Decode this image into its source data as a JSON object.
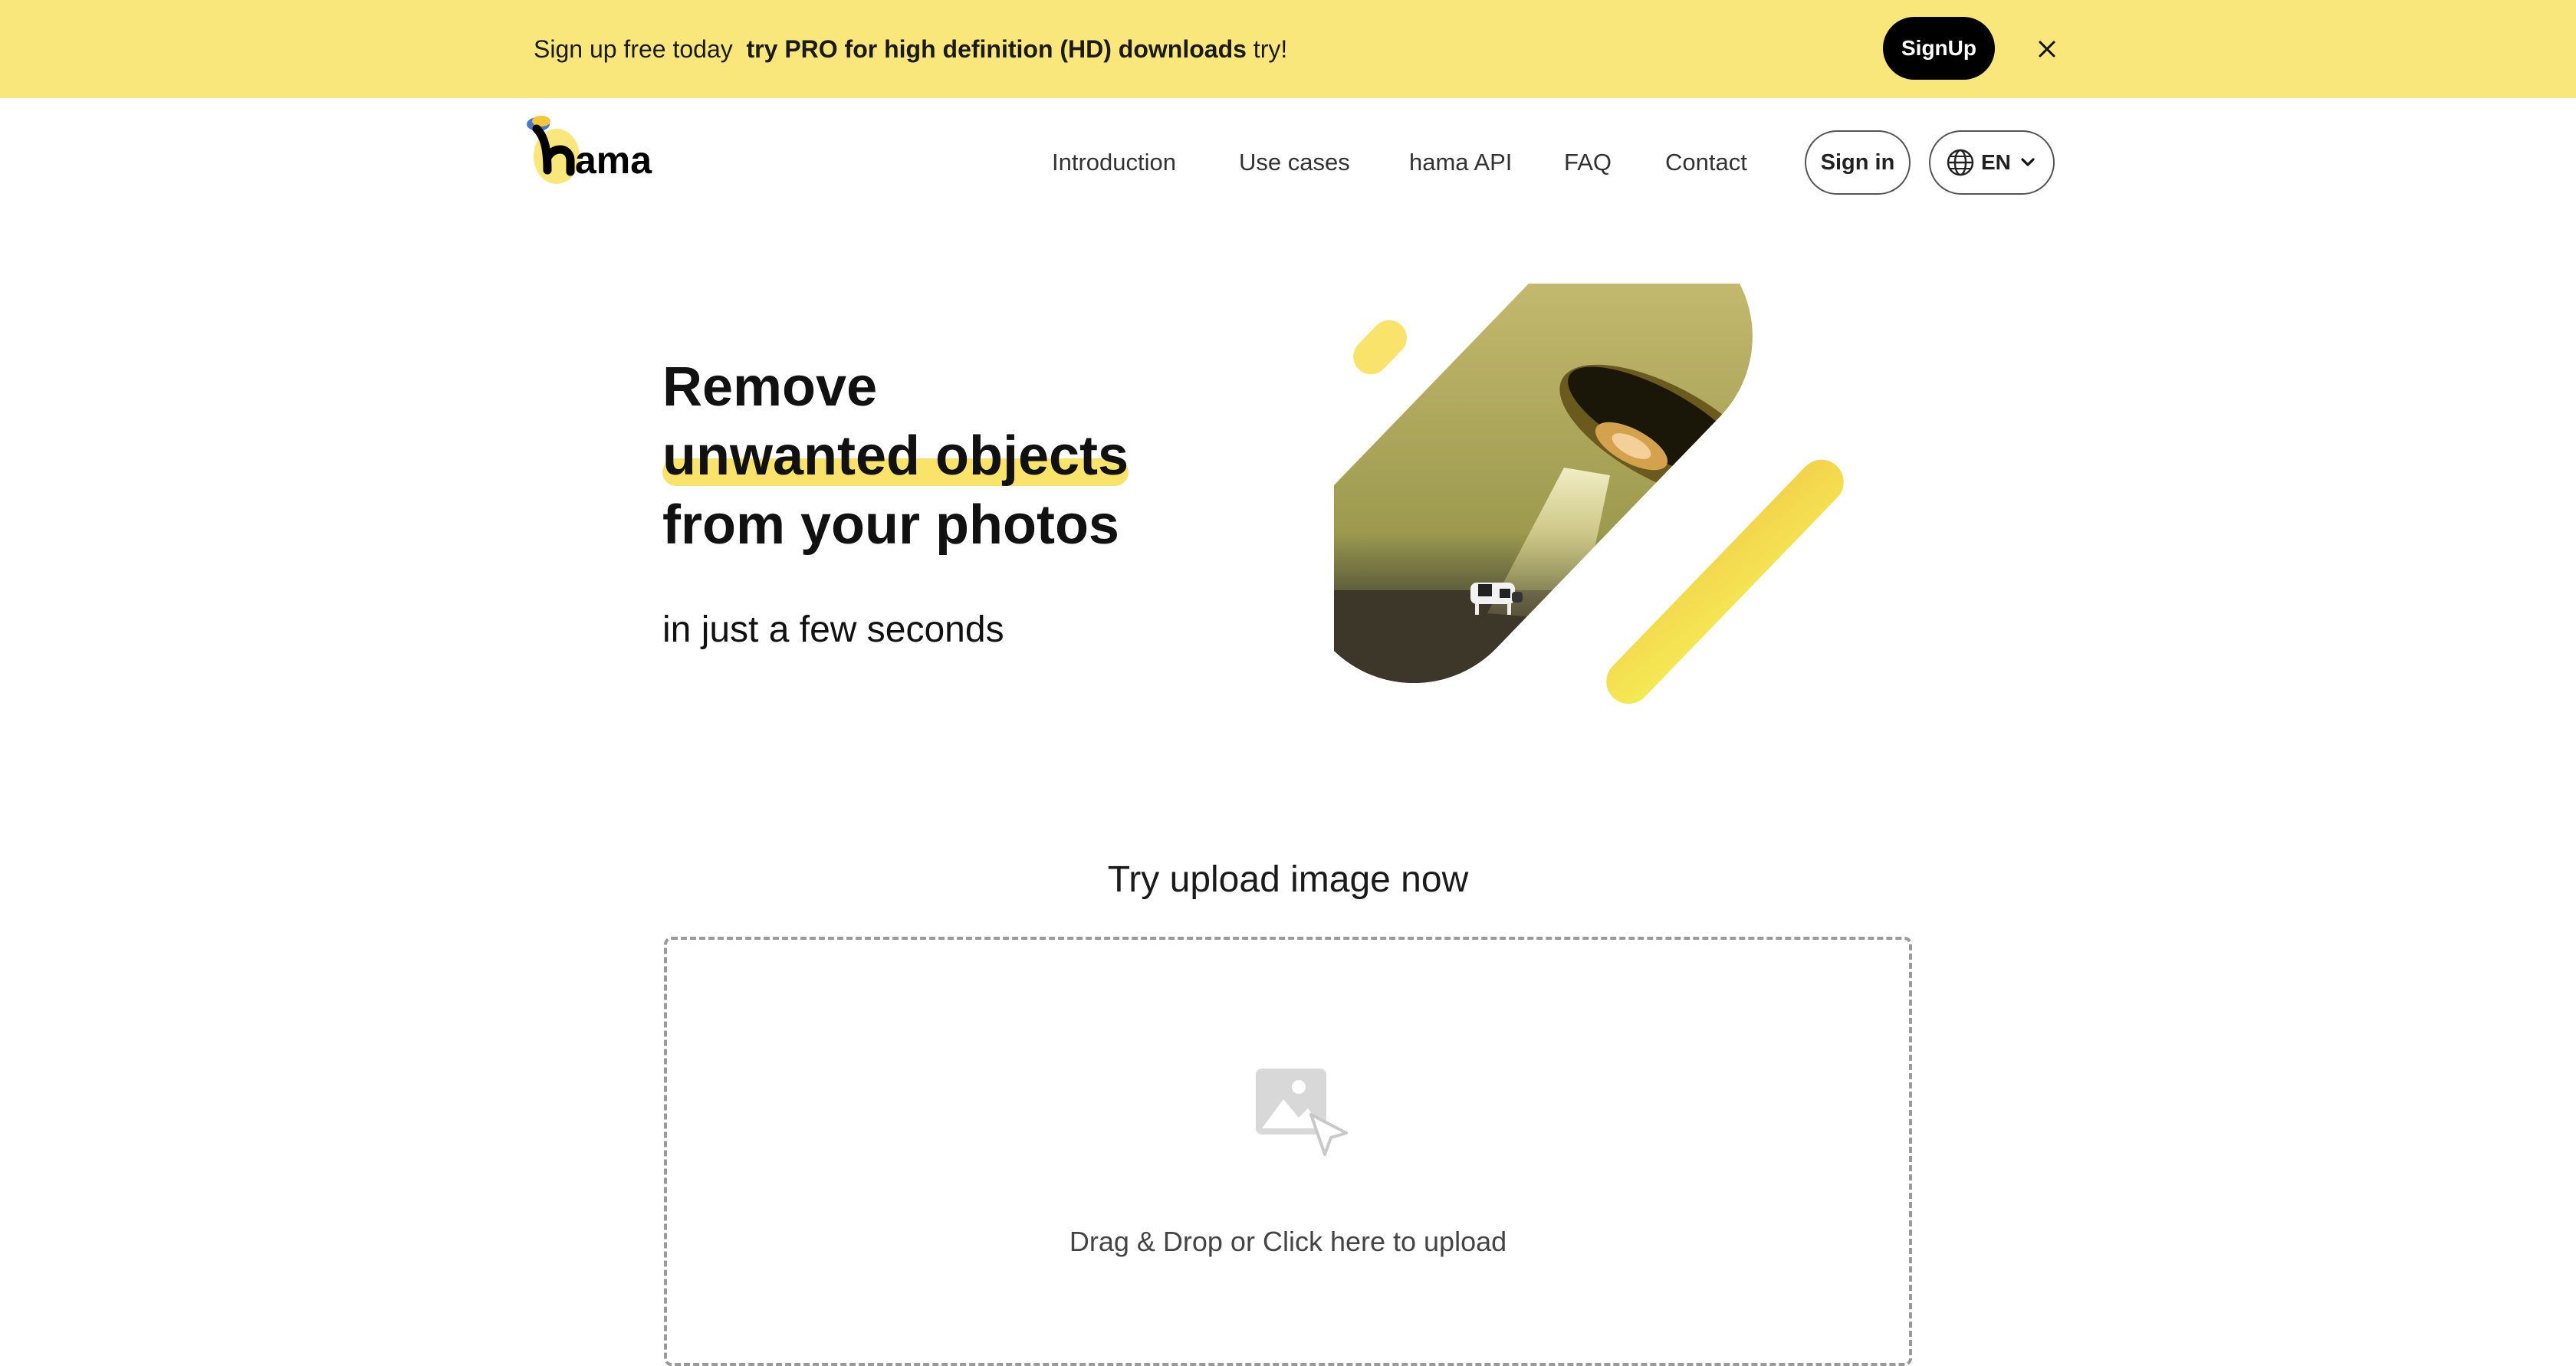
{
  "promo": {
    "lead": "Sign up free today",
    "bold": "try PRO for high definition (HD) downloads",
    "tail": "try!",
    "signup_label": "SignUp",
    "background": "#f9e77c"
  },
  "header": {
    "logo_text": "hama",
    "nav": [
      "Introduction",
      "Use cases",
      "hama API",
      "FAQ",
      "Contact"
    ],
    "signin_label": "Sign in",
    "language": "EN"
  },
  "hero": {
    "title_line1": "Remove",
    "title_line2": "unwanted objects",
    "title_line3": "from your photos",
    "subtitle": "in just a few seconds",
    "accent": "#f9e36a"
  },
  "upload": {
    "heading": "Try upload image now",
    "prompt": "Drag & Drop or Click here to upload"
  },
  "icons": [
    "close-icon",
    "globe-icon",
    "chevron-down-icon",
    "image-upload-icon"
  ]
}
